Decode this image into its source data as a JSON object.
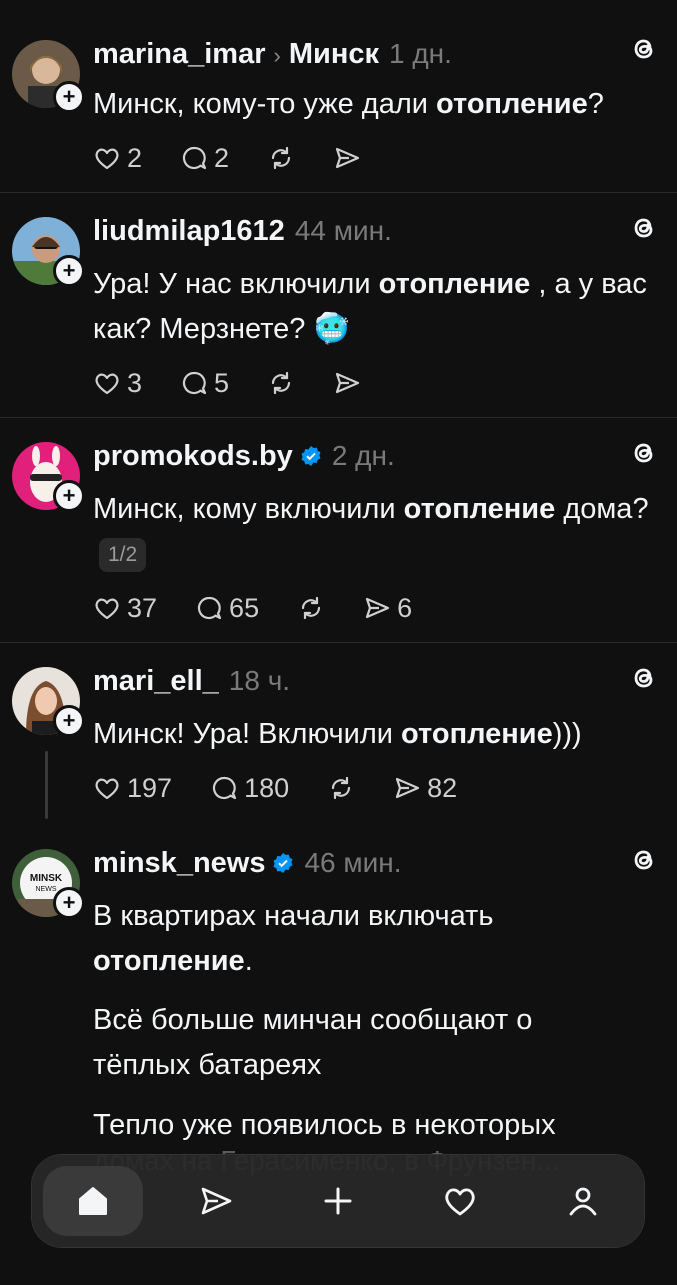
{
  "posts": [
    {
      "username": "marina_imar",
      "topic": "Минск",
      "time": "1 дн.",
      "verified": false,
      "text_before": "Минск, кому-то уже дали ",
      "text_bold": "отопление",
      "text_after": "?",
      "likes": "2",
      "replies": "2",
      "reposts": "",
      "shares": ""
    },
    {
      "username": "liudmilap1612",
      "time": "44 мин.",
      "verified": false,
      "text_before": "Ура! У нас включили ",
      "text_bold": "отопление",
      "text_after": " , а у вас как? Мерзнете? 🥶",
      "likes": "3",
      "replies": "5",
      "reposts": "",
      "shares": ""
    },
    {
      "username": "promokods.by",
      "time": "2 дн.",
      "verified": true,
      "text_before": "Минск, кому включили ",
      "text_bold": "отопление",
      "text_after": " дома?",
      "pager": "1/2",
      "likes": "37",
      "replies": "65",
      "reposts": "",
      "shares": "6"
    },
    {
      "username": "mari_ell_",
      "time": "18 ч.",
      "verified": false,
      "text_before": "Минск! Ура! Включили ",
      "text_bold": "отопление",
      "text_after": ")))",
      "likes": "197",
      "replies": "180",
      "reposts": "",
      "shares": "82"
    },
    {
      "username": "minsk_news",
      "time": "46 мин.",
      "verified": true,
      "avatar_text": "MINSK NEWS",
      "text_before": "В квартирах начали включать ",
      "text_bold": "отопление",
      "text_after": ".",
      "paragraph2": "Всё больше минчан сообщают о тёплых батареях",
      "paragraph3": "Тепло уже появилось в некоторых",
      "ghost_line": "домах на Герасименко, в Фрунзен..."
    }
  ],
  "nav": [
    "home-icon",
    "send-icon",
    "plus-icon",
    "heart-icon",
    "profile-icon"
  ],
  "colors": {
    "background": "#101010",
    "text": "#f3f5f7",
    "muted": "#7a7a7a",
    "verified": "#0095f6"
  }
}
